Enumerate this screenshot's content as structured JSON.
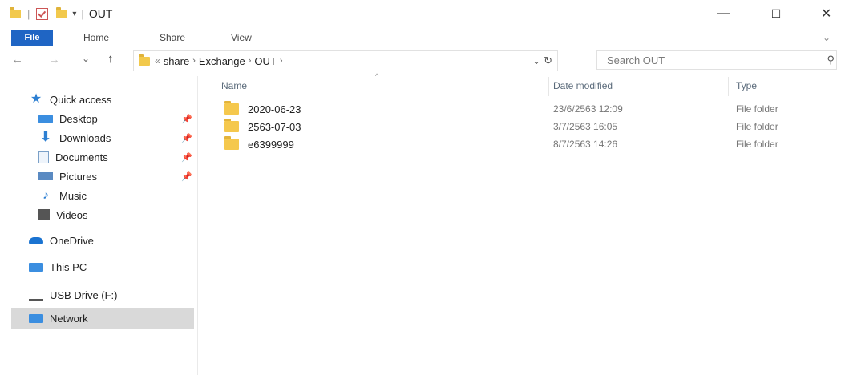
{
  "window": {
    "title": "OUT",
    "minimize": "—",
    "maximize": "☐",
    "close": "✕"
  },
  "ribbon": {
    "tabs": [
      "File",
      "Home",
      "Share",
      "View"
    ],
    "expand": "⌄"
  },
  "navigation": {
    "back": "←",
    "forward": "→",
    "recent": "⌄",
    "up": "↑",
    "overflow": "«",
    "path": [
      "share",
      "Exchange",
      "OUT"
    ],
    "dropdown": "⌄",
    "refresh": "↻"
  },
  "search": {
    "placeholder": "Search OUT",
    "icon": "⚲"
  },
  "sidebar": {
    "items": [
      {
        "label": "Quick access",
        "icon": "star-icon"
      },
      {
        "label": "Desktop",
        "icon": "desktop-icon",
        "pinned": true
      },
      {
        "label": "Downloads",
        "icon": "download-icon",
        "pinned": true
      },
      {
        "label": "Documents",
        "icon": "documents-icon",
        "pinned": true
      },
      {
        "label": "Pictures",
        "icon": "pictures-icon",
        "pinned": true
      },
      {
        "label": "Music",
        "icon": "music-icon"
      },
      {
        "label": "Videos",
        "icon": "videos-icon"
      },
      {
        "label": "OneDrive",
        "icon": "onedrive-icon"
      },
      {
        "label": "This PC",
        "icon": "this-pc-icon"
      },
      {
        "label": "USB Drive (F:)",
        "icon": "usb-drive-icon"
      },
      {
        "label": "Network",
        "icon": "network-icon",
        "selected": true
      }
    ],
    "pin_glyph": "📌"
  },
  "list": {
    "columns": [
      "Name",
      "Date modified",
      "Type"
    ],
    "sort_indicator": "^",
    "rows": [
      {
        "name": "2020-06-23",
        "date": "23/6/2563 12:09",
        "type": "File folder"
      },
      {
        "name": "2563-07-03",
        "date": "3/7/2563 16:05",
        "type": "File folder"
      },
      {
        "name": "e6399999",
        "date": "8/7/2563 14:26",
        "type": "File folder"
      }
    ]
  },
  "colors": {
    "accent": "#1f65c4",
    "folder": "#f5c84d",
    "selected": "#d9d9d9"
  }
}
